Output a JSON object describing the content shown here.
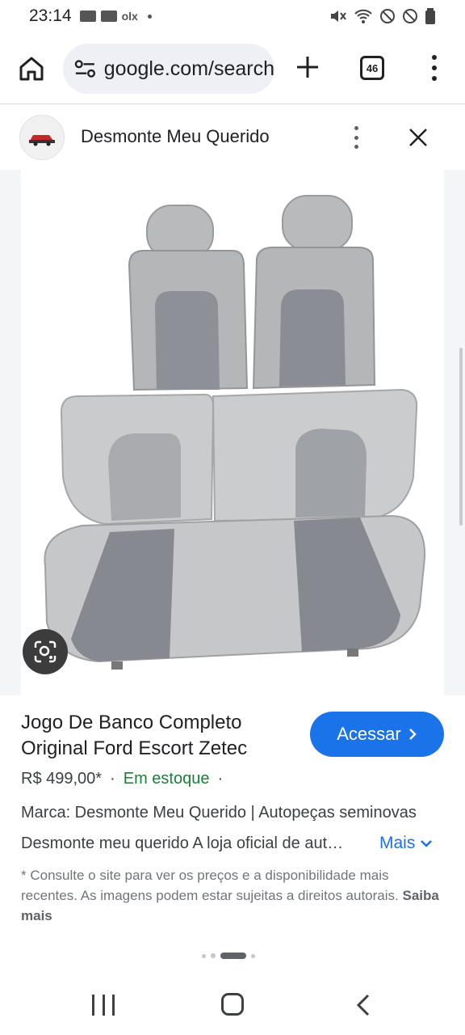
{
  "status_bar": {
    "time": "23:14",
    "olx_label": "olx"
  },
  "browser": {
    "url": "google.com/search",
    "tab_count": "46"
  },
  "source": {
    "name": "Desmonte Meu Querido"
  },
  "product": {
    "title": "Jogo De Banco Completo Original Ford Escort Zetec",
    "price": "R$ 499,00*",
    "separator": "·",
    "stock": "Em estoque",
    "brand_line": "Marca: Desmonte Meu Querido | Autopeças seminovas",
    "description": "Desmonte meu querido A loja oficial de autopeças",
    "more_label": "Mais",
    "access_label": "Acessar"
  },
  "disclaimer": {
    "text": "* Consulte o site para ver os preços e a disponibilidade mais recentes. As imagens podem estar sujeitas a direitos autorais.",
    "link": "Saiba mais"
  },
  "colors": {
    "accent": "#1a73e8",
    "stock_green": "#188038",
    "text_primary": "#202124",
    "text_secondary": "#70757a"
  },
  "icons": {
    "home": "home-icon",
    "site_settings": "tune-icon",
    "new_tab": "plus-icon",
    "tabs": "tab-switcher-icon",
    "menu": "more-vert-icon",
    "close": "close-icon",
    "lens": "google-lens-icon",
    "chevron_right": "chevron-right-icon",
    "chevron_down": "chevron-down-icon"
  }
}
